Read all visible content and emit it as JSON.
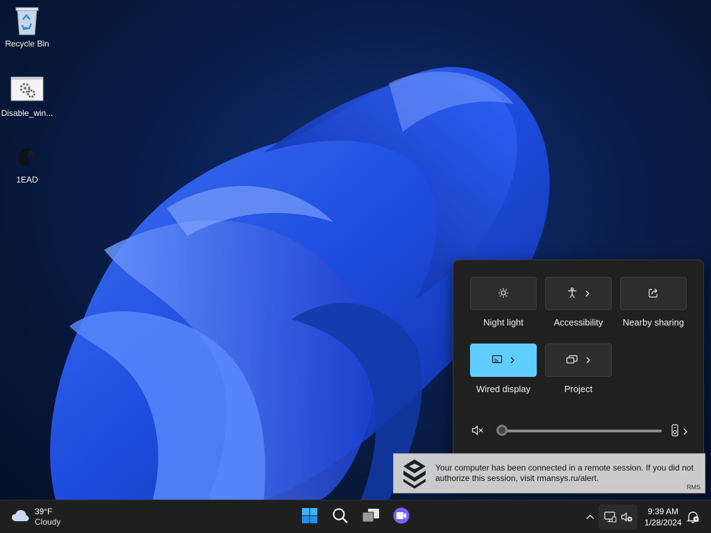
{
  "desktop": {
    "icons": [
      {
        "label": "Recycle Bin",
        "icon": "recycle-bin-icon"
      },
      {
        "label": "Disable_win...",
        "icon": "settings-shortcut-icon"
      },
      {
        "label": "1EAD",
        "icon": "app-shortcut-icon"
      }
    ]
  },
  "quick_settings": {
    "tiles": [
      {
        "label": "Night light",
        "icon": "night-light-icon",
        "active": false,
        "has_chevron": false
      },
      {
        "label": "Accessibility",
        "icon": "accessibility-icon",
        "active": false,
        "has_chevron": true
      },
      {
        "label": "Nearby sharing",
        "icon": "share-icon",
        "active": false,
        "has_chevron": false
      },
      {
        "label": "Wired display",
        "icon": "cast-icon",
        "active": true,
        "has_chevron": true
      },
      {
        "label": "Project",
        "icon": "project-icon",
        "active": false,
        "has_chevron": true
      }
    ],
    "volume": {
      "muted": true,
      "level_percent": 0
    },
    "accent_color": "#60cdff"
  },
  "notification": {
    "message": "Your computer has been connected in a remote session. If you did not authorize this session, visit rmansys.ru/alert.",
    "brand": "RMS"
  },
  "taskbar": {
    "weather": {
      "temp": "39°F",
      "condition": "Cloudy"
    },
    "clock": {
      "time": "9:39 AM",
      "date": "1/28/2024"
    }
  }
}
